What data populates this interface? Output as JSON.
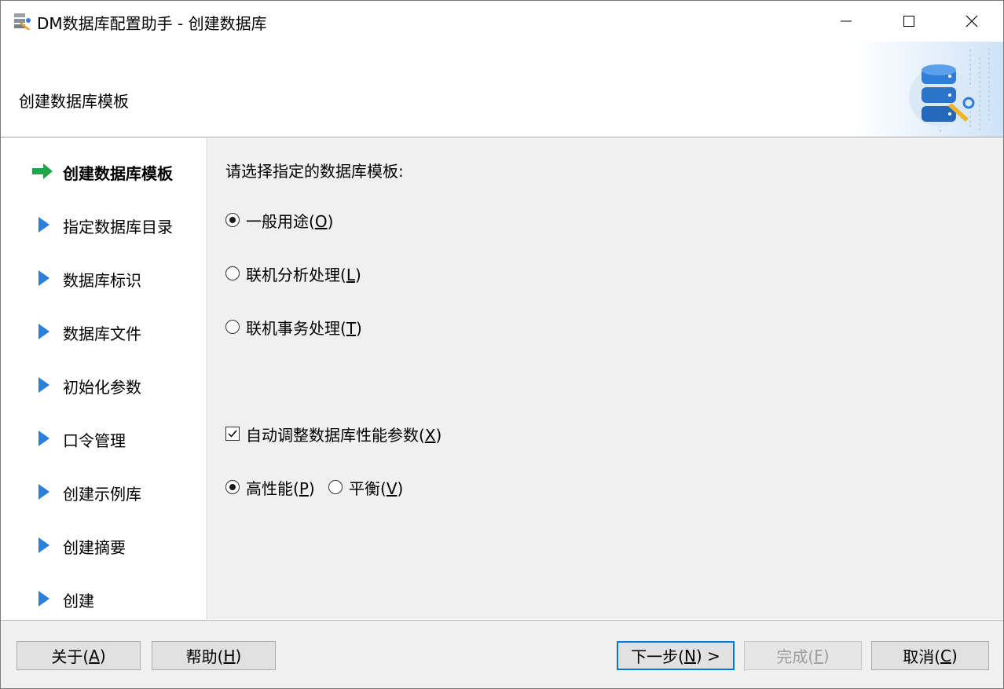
{
  "window": {
    "title": "DM数据库配置助手 - 创建数据库",
    "controls": {
      "minimize": "minimize-icon",
      "maximize": "maximize-icon",
      "close": "close-icon"
    }
  },
  "header": {
    "title": "创建数据库模板",
    "art_icon": "database-wrench-icon"
  },
  "nav": {
    "items": [
      {
        "label": "创建数据库模板",
        "active": true,
        "icon": "arrow-right-icon"
      },
      {
        "label": "指定数据库目录",
        "active": false,
        "icon": "triangle-right-icon"
      },
      {
        "label": "数据库标识",
        "active": false,
        "icon": "triangle-right-icon"
      },
      {
        "label": "数据库文件",
        "active": false,
        "icon": "triangle-right-icon"
      },
      {
        "label": "初始化参数",
        "active": false,
        "icon": "triangle-right-icon"
      },
      {
        "label": "口令管理",
        "active": false,
        "icon": "triangle-right-icon"
      },
      {
        "label": "创建示例库",
        "active": false,
        "icon": "triangle-right-icon"
      },
      {
        "label": "创建摘要",
        "active": false,
        "icon": "triangle-right-icon"
      },
      {
        "label": "创建",
        "active": false,
        "icon": "triangle-right-icon"
      }
    ]
  },
  "content": {
    "prompt": "请选择指定的数据库模板:",
    "templates": [
      {
        "text": "一般用途(",
        "key": "O",
        "close": ")",
        "selected": true
      },
      {
        "text": "联机分析处理(",
        "key": "L",
        "close": ")",
        "selected": false
      },
      {
        "text": "联机事务处理(",
        "key": "T",
        "close": ")",
        "selected": false
      }
    ],
    "auto_tune": {
      "text": "自动调整数据库性能参数(",
      "key": "X",
      "close": ")",
      "checked": true
    },
    "performance": [
      {
        "text": "高性能(",
        "key": "P",
        "close": ")",
        "selected": true
      },
      {
        "text": "平衡(",
        "key": "V",
        "close": ")",
        "selected": false
      }
    ]
  },
  "footer": {
    "about": {
      "text": "关于(",
      "key": "A",
      "close": ")"
    },
    "help": {
      "text": "帮助(",
      "key": "H",
      "close": ")"
    },
    "next": {
      "text": "下一步(",
      "key": "N",
      "close": ") >"
    },
    "finish": {
      "text": "完成(",
      "key": "F",
      "close": ")",
      "disabled": true
    },
    "cancel": {
      "text": "取消(",
      "key": "C",
      "close": ")"
    }
  },
  "colors": {
    "accent": "#0078d7",
    "nav_active_arrow": "#22a44a",
    "nav_triangle": "#2f7fd8",
    "content_bg": "#f0f0f0"
  }
}
